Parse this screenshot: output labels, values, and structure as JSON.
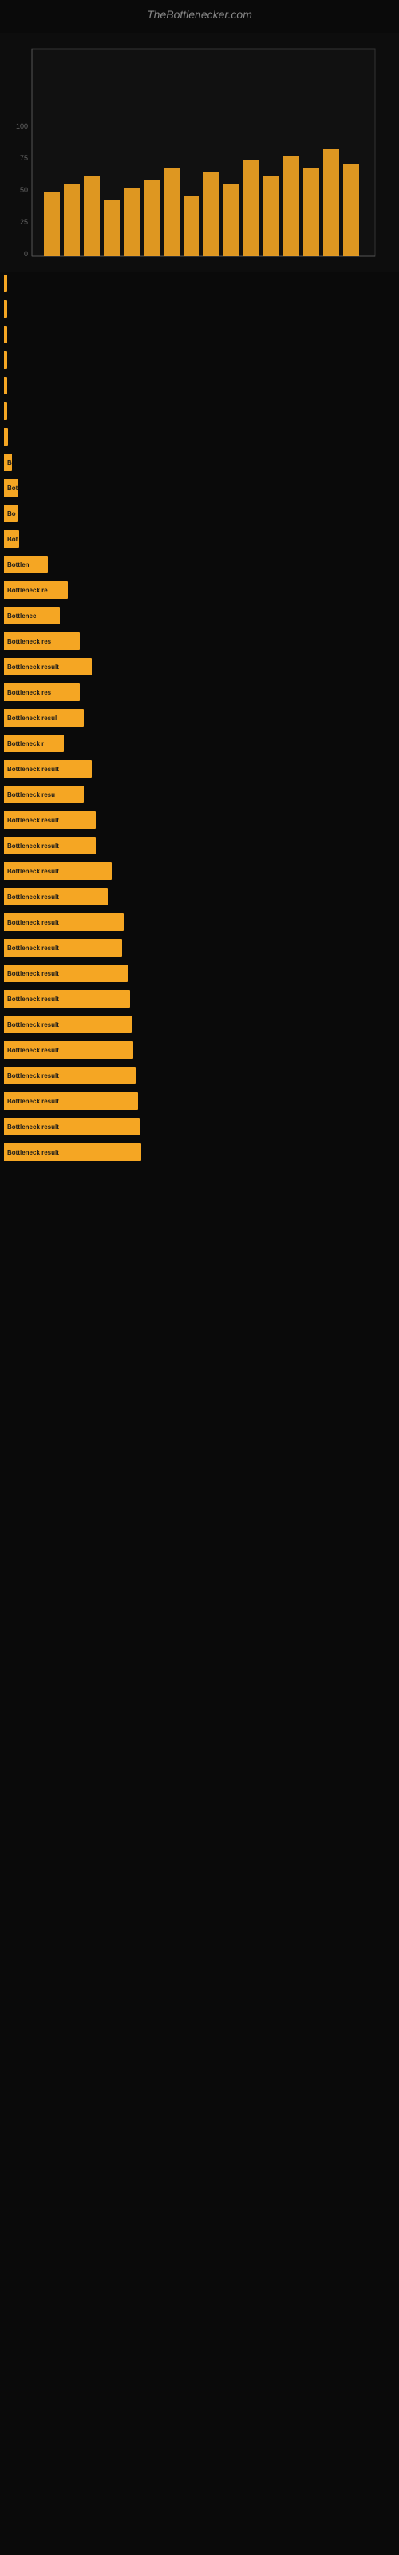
{
  "site": {
    "title": "TheBottlenecker.com"
  },
  "bars": [
    {
      "label": "",
      "width": 2,
      "text": "",
      "textVisible": false
    },
    {
      "label": "",
      "width": 2,
      "text": "",
      "textVisible": false
    },
    {
      "label": "",
      "width": 3,
      "text": "",
      "textVisible": false
    },
    {
      "label": "",
      "width": 2,
      "text": "",
      "textVisible": false
    },
    {
      "label": "",
      "width": 2,
      "text": "",
      "textVisible": false
    },
    {
      "label": "",
      "width": 4,
      "text": "",
      "textVisible": false
    },
    {
      "label": "",
      "width": 5,
      "text": "",
      "textVisible": false
    },
    {
      "label": "",
      "width": 10,
      "text": "B",
      "textVisible": true
    },
    {
      "label": "",
      "width": 18,
      "text": "Bot",
      "textVisible": true
    },
    {
      "label": "",
      "width": 17,
      "text": "Bo",
      "textVisible": true
    },
    {
      "label": "",
      "width": 19,
      "text": "Bot",
      "textVisible": true
    },
    {
      "label": "",
      "width": 55,
      "text": "Bottlen",
      "textVisible": true
    },
    {
      "label": "",
      "width": 80,
      "text": "Bottleneck re",
      "textVisible": true
    },
    {
      "label": "",
      "width": 70,
      "text": "Bottlenec",
      "textVisible": true
    },
    {
      "label": "",
      "width": 95,
      "text": "Bottleneck res",
      "textVisible": true
    },
    {
      "label": "",
      "width": 110,
      "text": "Bottleneck result",
      "textVisible": true
    },
    {
      "label": "",
      "width": 95,
      "text": "Bottleneck res",
      "textVisible": true
    },
    {
      "label": "",
      "width": 100,
      "text": "Bottleneck resul",
      "textVisible": true
    },
    {
      "label": "",
      "width": 75,
      "text": "Bottleneck r",
      "textVisible": true
    },
    {
      "label": "",
      "width": 110,
      "text": "Bottleneck result",
      "textVisible": true
    },
    {
      "label": "",
      "width": 100,
      "text": "Bottleneck resu",
      "textVisible": true
    },
    {
      "label": "",
      "width": 115,
      "text": "Bottleneck result",
      "textVisible": true
    },
    {
      "label": "",
      "width": 115,
      "text": "Bottleneck result",
      "textVisible": true
    },
    {
      "label": "",
      "width": 135,
      "text": "Bottleneck result",
      "textVisible": true
    },
    {
      "label": "",
      "width": 130,
      "text": "Bottleneck result",
      "textVisible": true
    },
    {
      "label": "",
      "width": 150,
      "text": "Bottleneck result",
      "textVisible": true
    },
    {
      "label": "",
      "width": 148,
      "text": "Bottleneck result",
      "textVisible": true
    },
    {
      "label": "",
      "width": 155,
      "text": "Bottleneck result",
      "textVisible": true
    },
    {
      "label": "",
      "width": 158,
      "text": "Bottleneck result",
      "textVisible": true
    },
    {
      "label": "",
      "width": 160,
      "text": "Bottleneck result",
      "textVisible": true
    },
    {
      "label": "",
      "width": 162,
      "text": "Bottleneck result",
      "textVisible": true
    },
    {
      "label": "",
      "width": 165,
      "text": "Bottleneck result",
      "textVisible": true
    },
    {
      "label": "",
      "width": 168,
      "text": "Bottleneck result",
      "textVisible": true
    },
    {
      "label": "",
      "width": 170,
      "text": "Bottleneck result",
      "textVisible": true
    },
    {
      "label": "",
      "width": 172,
      "text": "Bottleneck result",
      "textVisible": true
    }
  ]
}
